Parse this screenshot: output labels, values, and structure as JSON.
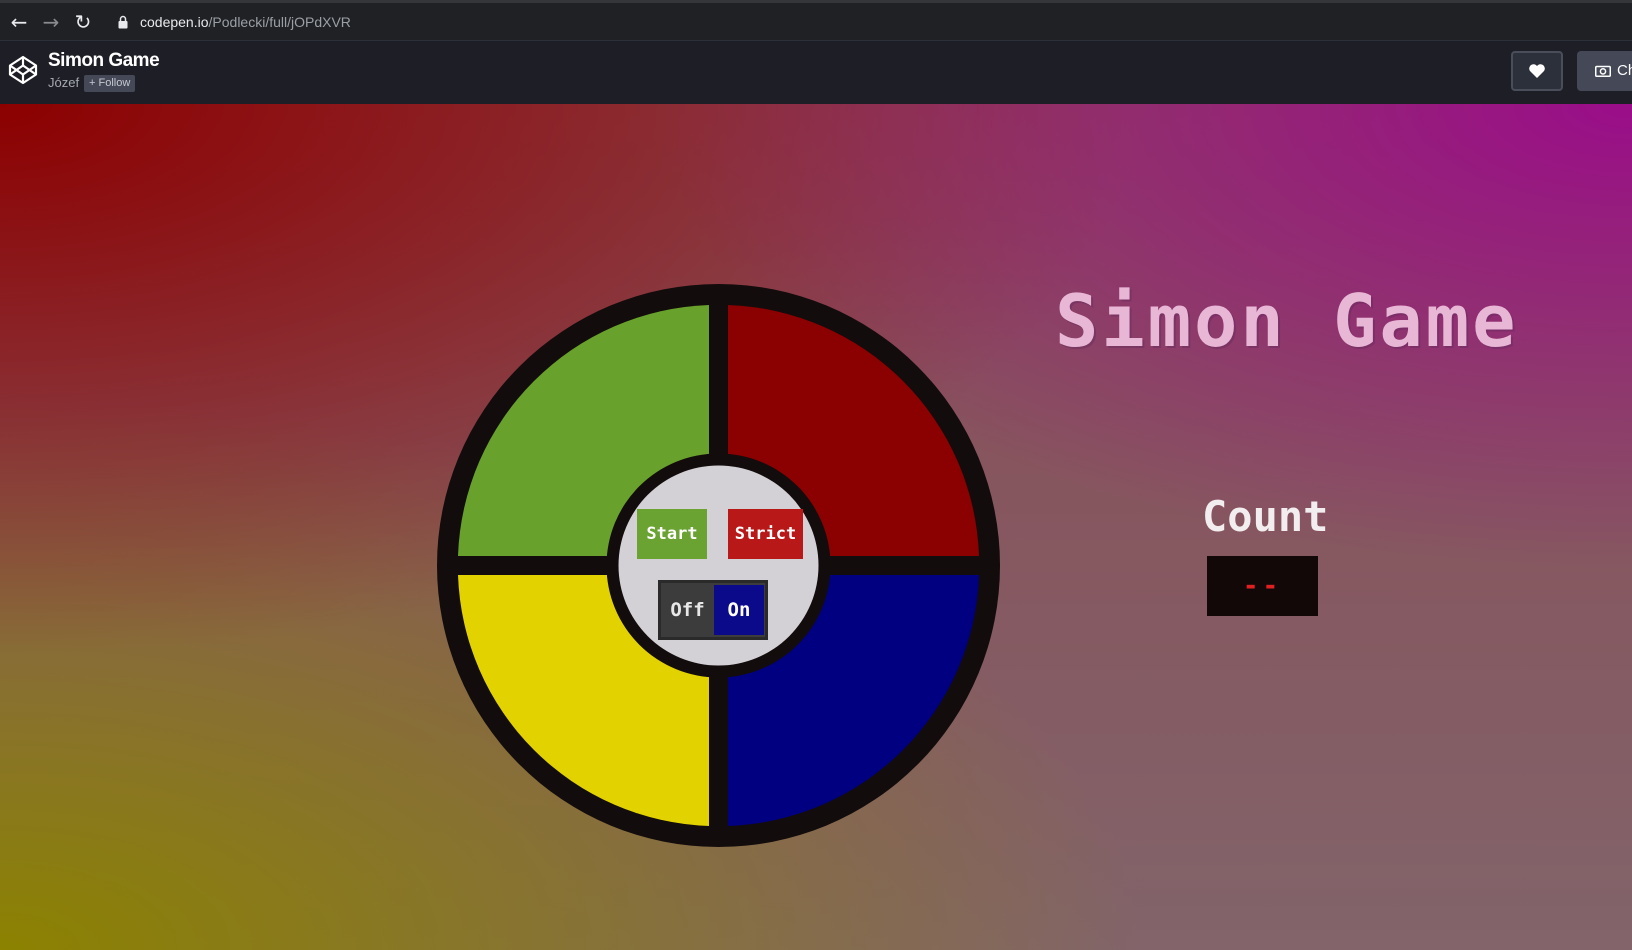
{
  "browser": {
    "back_icon": "arrow-left-icon",
    "forward_icon": "arrow-right-icon",
    "reload_icon": "reload-icon",
    "lock_icon": "lock-icon",
    "url_host": "codepen.io",
    "url_path": "/Podlecki/full/jOPdXVR"
  },
  "codepen": {
    "title": "Simon Game",
    "author": "Józef",
    "follow_label": "+ Follow",
    "heart_icon": "heart-icon",
    "change_icon": "camera-icon",
    "change_label": "Ch"
  },
  "game": {
    "title": "Simon Game",
    "count_label": "Count",
    "count_value": "--",
    "start_label": "Start",
    "strict_label": "Strict",
    "off_label": "Off",
    "on_label": "On",
    "power_state": "On",
    "colors": {
      "green": "#68a12b",
      "red": "#8b0000",
      "yellow": "#e2d200",
      "blue": "#000080",
      "ring": "#120c0c",
      "center": "#d4d1d6",
      "count_text": "#e02020",
      "title_text": "#e9b7d6"
    }
  }
}
